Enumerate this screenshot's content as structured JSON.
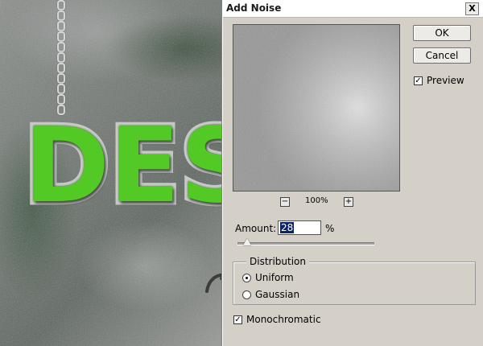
{
  "background": {
    "text": "DES",
    "accent_color": "#53c926"
  },
  "dialog": {
    "title": "Add Noise",
    "close_label": "X",
    "ok_label": "OK",
    "cancel_label": "Cancel",
    "preview_label": "Preview",
    "preview_checked": true,
    "zoom_minus": "−",
    "zoom_plus": "+",
    "zoom_level": "100%",
    "amount_label": "Amount:",
    "amount_value": "28",
    "amount_unit": "%",
    "amount_slider_fraction": 0.07,
    "distribution_label": "Distribution",
    "uniform_label": "Uniform",
    "gaussian_label": "Gaussian",
    "selected_distribution": "Uniform",
    "monochromatic_label": "Monochromatic",
    "monochromatic_checked": true
  }
}
